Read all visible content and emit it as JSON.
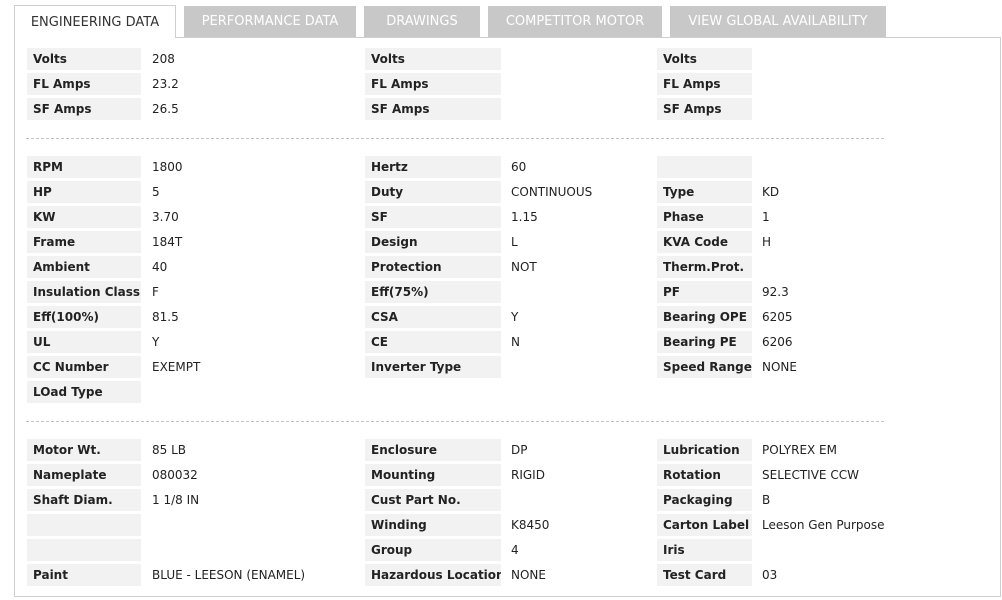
{
  "tabs": [
    {
      "label": "ENGINEERING DATA",
      "active": true
    },
    {
      "label": "PERFORMANCE DATA",
      "active": false
    },
    {
      "label": "DRAWINGS",
      "active": false
    },
    {
      "label": "COMPETITOR MOTOR",
      "active": false
    },
    {
      "label": "VIEW GLOBAL AVAILABILITY",
      "active": false
    }
  ],
  "sections": [
    {
      "rows": [
        [
          [
            "Volts",
            "208"
          ],
          [
            "Volts",
            ""
          ],
          [
            "Volts",
            ""
          ]
        ],
        [
          [
            "FL Amps",
            "23.2"
          ],
          [
            "FL Amps",
            ""
          ],
          [
            "FL Amps",
            ""
          ]
        ],
        [
          [
            "SF Amps",
            "26.5"
          ],
          [
            "SF Amps",
            ""
          ],
          [
            "SF Amps",
            ""
          ]
        ]
      ]
    },
    {
      "rows": [
        [
          [
            "RPM",
            "1800"
          ],
          [
            "Hertz",
            "60"
          ],
          [
            "",
            ""
          ]
        ],
        [
          [
            "HP",
            "5"
          ],
          [
            "Duty",
            "CONTINUOUS"
          ],
          [
            "Type",
            "KD"
          ]
        ],
        [
          [
            "KW",
            "3.70"
          ],
          [
            "SF",
            "1.15"
          ],
          [
            "Phase",
            "1"
          ]
        ],
        [
          [
            "Frame",
            "184T"
          ],
          [
            "Design",
            "L"
          ],
          [
            "KVA Code",
            "H"
          ]
        ],
        [
          [
            "Ambient",
            "40"
          ],
          [
            "Protection",
            "NOT"
          ],
          [
            "Therm.Prot.",
            ""
          ]
        ],
        [
          [
            "Insulation Class",
            "F"
          ],
          [
            "Eff(75%)",
            ""
          ],
          [
            "PF",
            "92.3"
          ]
        ],
        [
          [
            "Eff(100%)",
            "81.5"
          ],
          [
            "CSA",
            "Y"
          ],
          [
            "Bearing OPE",
            "6205"
          ]
        ],
        [
          [
            "UL",
            "Y"
          ],
          [
            "CE",
            "N"
          ],
          [
            "Bearing PE",
            "6206"
          ]
        ],
        [
          [
            "CC Number",
            "EXEMPT"
          ],
          [
            "Inverter Type",
            ""
          ],
          [
            "Speed Range",
            "NONE"
          ]
        ],
        [
          [
            "LOad Type",
            ""
          ],
          null,
          null
        ]
      ]
    },
    {
      "rows": [
        [
          [
            "Motor Wt.",
            "85 LB"
          ],
          [
            "Enclosure",
            "DP"
          ],
          [
            "Lubrication",
            "POLYREX EM"
          ]
        ],
        [
          [
            "Nameplate",
            "080032"
          ],
          [
            "Mounting",
            "RIGID"
          ],
          [
            "Rotation",
            "SELECTIVE CCW"
          ]
        ],
        [
          [
            "Shaft Diam.",
            "1 1/8 IN"
          ],
          [
            "Cust Part No.",
            ""
          ],
          [
            "Packaging",
            "B"
          ]
        ],
        [
          [
            "",
            ""
          ],
          [
            "Winding",
            "K8450"
          ],
          [
            "Carton Label",
            "Leeson Gen Purpose"
          ]
        ],
        [
          [
            "",
            ""
          ],
          [
            "Group",
            "4"
          ],
          [
            "Iris",
            ""
          ]
        ],
        [
          [
            "Paint",
            "BLUE - LEESON (ENAMEL)"
          ],
          [
            "Hazardous Location",
            "NONE"
          ],
          [
            "Test Card",
            "03"
          ]
        ]
      ]
    }
  ]
}
